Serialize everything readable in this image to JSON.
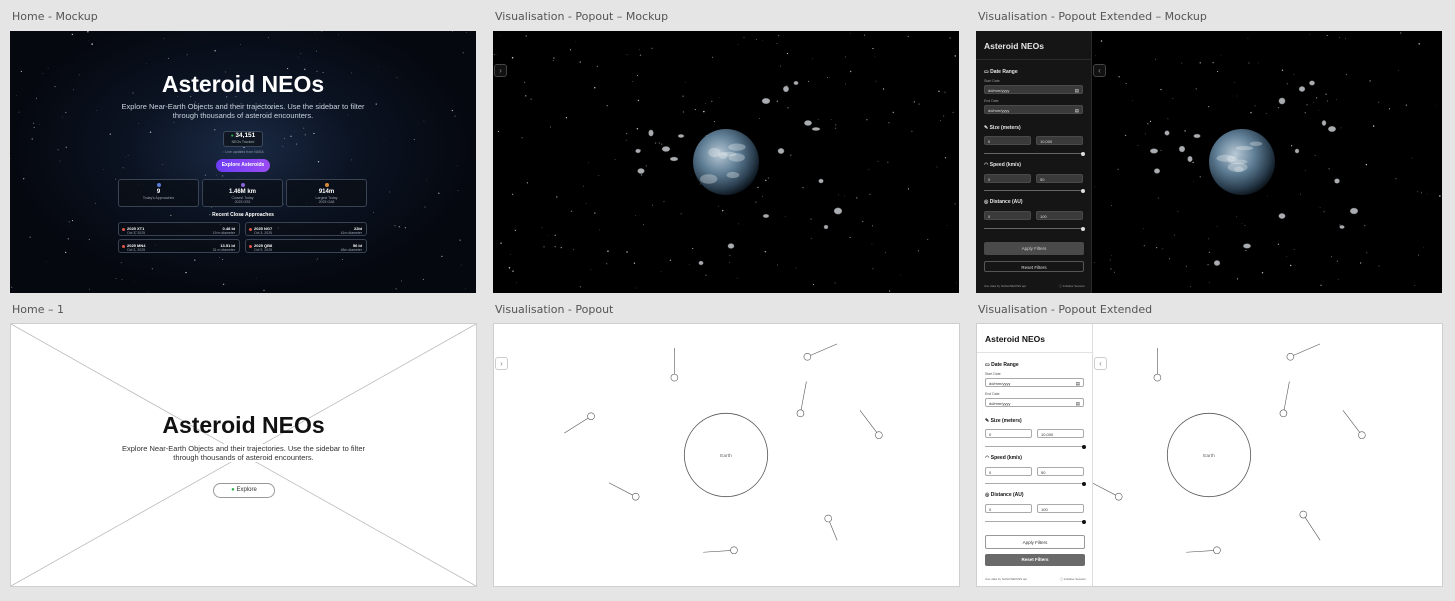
{
  "frames": {
    "home_mockup": "Home - Mockup",
    "vis_popout_mockup": "Visualisation - Popout – Mockup",
    "vis_popout_ext_mockup": "Visualisation - Popout Extended – Mockup",
    "home_1": "Home – 1",
    "vis_popout": "Visualisation - Popout",
    "vis_popout_ext": "Visualisation - Popout Extended"
  },
  "home": {
    "title": "Asteroid NEOs",
    "subtitle": "Explore Near-Earth Objects and their trajectories. Use the sidebar to filter through thousands of asteroid encounters.",
    "counter_value": "34,151",
    "counter_label": "NEOs Tracked",
    "live_text": "Live updates from NASA",
    "explore_button": "Explore Asteroids",
    "stats": [
      {
        "value": "9",
        "label": "Today's Approaches",
        "sub": ""
      },
      {
        "value": "1.46M km",
        "label": "Closest Today",
        "sub": "2025 OS3"
      },
      {
        "value": "914m",
        "label": "Largest Today",
        "sub": "2025 GA8"
      }
    ],
    "recent_title": "Recent Close Approaches",
    "approaches": [
      {
        "name": "2025 XT1",
        "date": "Oct 3, 2025",
        "miss": "0.48 ld",
        "size": "19 m diameter"
      },
      {
        "name": "2025 NG7",
        "date": "Oct 3, 2025",
        "miss": "22ld",
        "size": "41m diameter"
      },
      {
        "name": "2025 MN4",
        "date": "Oct 3, 2025",
        "miss": "13.51 ld",
        "size": "31 m diameter"
      },
      {
        "name": "2025 QB8",
        "date": "Oct 3, 2025",
        "miss": "56 ld",
        "size": "48m diameter"
      }
    ]
  },
  "wireframe": {
    "title": "Asteroid NEOs",
    "subtitle": "Explore Near-Earth Objects and their trajectories. Use the sidebar to filter through thousands of asteroid encounters.",
    "explore_button": "Explore",
    "earth_label": "Earth"
  },
  "sidebar": {
    "title": "Asteroid NEOs",
    "date_range": "Date Range",
    "start_date_label": "Start Date",
    "end_date_label": "End Date",
    "date_placeholder": "dd/mm/yyyy",
    "size_label": "Size (meters)",
    "size_min": "0",
    "size_max": "10,000",
    "speed_label": "Speed (km/s)",
    "speed_min": "0",
    "speed_max": "50",
    "distance_label": "Distance (AU)",
    "distance_min": "0",
    "distance_max": "100",
    "apply_button": "Apply Filters",
    "reset_button": "Reset Filters",
    "footer_left": "Use data by NASA/NEOWS api",
    "footer_right": "Initialise Session"
  },
  "colors": {
    "accent": "#7a44f3",
    "dark_bg": "#000000",
    "sidebar_dark": "#151515"
  }
}
